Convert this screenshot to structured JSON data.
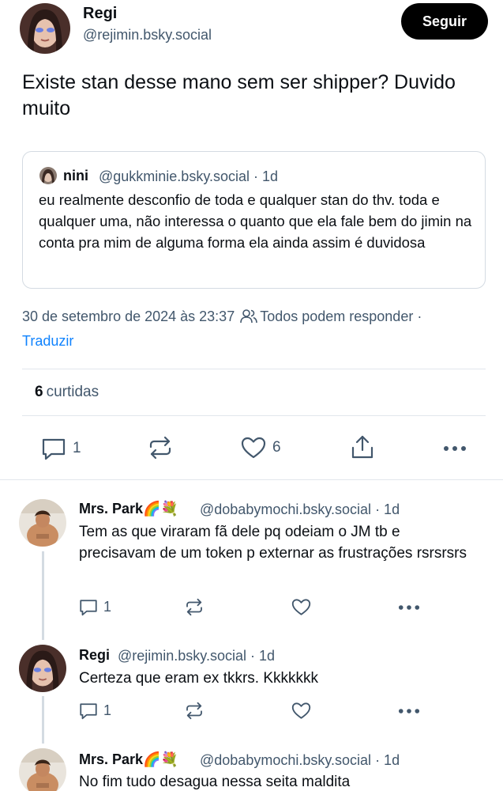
{
  "post": {
    "author": {
      "display_name": "Regi",
      "handle": "@rejimin.bsky.social"
    },
    "follow_label": "Seguir",
    "text": "Existe stan desse mano sem ser shipper? Duvido muito",
    "quote": {
      "display_name": "nini",
      "handle": "@gukkminie.bsky.social",
      "age": "· 1d",
      "text": "eu realmente desconfio de toda e qualquer stan do thv. toda e qualquer uma, não interessa o quanto que ela fale bem do jimin na conta pra mim de alguma forma ela ainda assim é duvidosa"
    },
    "timestamp": "30 de setembro de 2024 às 23:37",
    "reply_setting": "Todos podem responder ·",
    "translate_label": "Traduzir",
    "like_count": "6",
    "like_label": "curtidas",
    "actions": {
      "reply_count": "1",
      "like_count": "6"
    }
  },
  "replies": [
    {
      "display_name": "Mrs. Park🌈💐",
      "handle": "@dobabymochi.bsky.social",
      "age": "· 1d",
      "text": "Tem as que viraram fã dele pq odeiam o JM  tb e precisavam de um token p externar as frustrações rsrsrsrs",
      "reply_count": "1"
    },
    {
      "display_name": "Regi",
      "handle": "@rejimin.bsky.social",
      "age": "· 1d",
      "text": "Certeza que eram ex tkkrs. Kkkkkkk",
      "reply_count": "1"
    },
    {
      "display_name": "Mrs. Park🌈💐",
      "handle": "@dobabymochi.bsky.social",
      "age": "· 1d",
      "text": "No fim tudo desagua nessa seita maldita"
    }
  ],
  "colors": {
    "text": "#0b0f14",
    "muted": "#42576c",
    "link": "#1083fe",
    "border": "#d4dbe2",
    "button": "#000000"
  },
  "icons": [
    "reply-icon",
    "repost-icon",
    "like-icon",
    "share-icon",
    "more-icon",
    "people-icon"
  ]
}
